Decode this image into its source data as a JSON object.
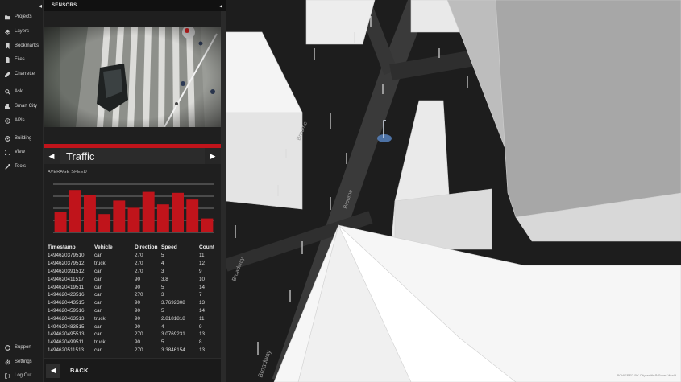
{
  "nav": {
    "items": [
      {
        "label": "Projects",
        "icon": "folder-icon"
      },
      {
        "label": "Layers",
        "icon": "layers-icon"
      },
      {
        "label": "Bookmarks",
        "icon": "bookmark-icon"
      },
      {
        "label": "Files",
        "icon": "file-icon"
      },
      {
        "label": "Charrette",
        "icon": "pencil-icon"
      },
      {
        "label": "Ask",
        "icon": "search-icon"
      },
      {
        "label": "Smart City",
        "icon": "city-icon"
      },
      {
        "label": "APIs",
        "icon": "api-icon"
      },
      {
        "label": "Building",
        "icon": "building-icon"
      },
      {
        "label": "View",
        "icon": "view-icon"
      },
      {
        "label": "Tools",
        "icon": "wrench-icon"
      }
    ],
    "bottom": [
      {
        "label": "Support",
        "icon": "support-icon"
      },
      {
        "label": "Settings",
        "icon": "gear-icon"
      },
      {
        "label": "Log Out",
        "icon": "logout-icon"
      }
    ]
  },
  "panel": {
    "title": "SENSORS",
    "sensor_name": "Traffic",
    "metric_label": "AVERAGE SPEED",
    "back_label": "BACK"
  },
  "chart_data": {
    "type": "bar",
    "values": [
      4.2,
      8.8,
      7.8,
      3.8,
      6.6,
      5.1,
      8.4,
      5.8,
      8.2,
      6.8,
      2.9
    ],
    "grid": true,
    "bar_color": "#c0141b"
  },
  "table": {
    "headers": [
      "Timestamp",
      "Vehicle",
      "Direction",
      "Speed",
      "Count"
    ],
    "rows": [
      [
        "1494620379510",
        "car",
        "270",
        "5",
        "11"
      ],
      [
        "1494620379512",
        "truck",
        "270",
        "4",
        "12"
      ],
      [
        "1494620391512",
        "car",
        "270",
        "3",
        "9"
      ],
      [
        "1494620411517",
        "car",
        "90",
        "3.8",
        "10"
      ],
      [
        "1494620419511",
        "car",
        "90",
        "5",
        "14"
      ],
      [
        "1494620423516",
        "car",
        "270",
        "3",
        "7"
      ],
      [
        "1494620443515",
        "car",
        "90",
        "3.7692308",
        "13"
      ],
      [
        "1494620459516",
        "car",
        "90",
        "5",
        "14"
      ],
      [
        "1494620463513",
        "truck",
        "90",
        "2.8181818",
        "11"
      ],
      [
        "1494620483515",
        "car",
        "90",
        "4",
        "9"
      ],
      [
        "1494620495513",
        "car",
        "270",
        "3.0769231",
        "13"
      ],
      [
        "1494620499511",
        "truck",
        "90",
        "5",
        "8"
      ],
      [
        "1494620511513",
        "car",
        "270",
        "3.3846154",
        "13"
      ]
    ]
  },
  "map": {
    "streets": [
      "Broadway",
      "Broome",
      "Broome"
    ],
    "credit": "POWERED BY Cityzenith ⊕ Smart World"
  },
  "colors": {
    "accent": "#c0141b",
    "panel": "#1f1f1f",
    "map_bg": "#202020"
  }
}
